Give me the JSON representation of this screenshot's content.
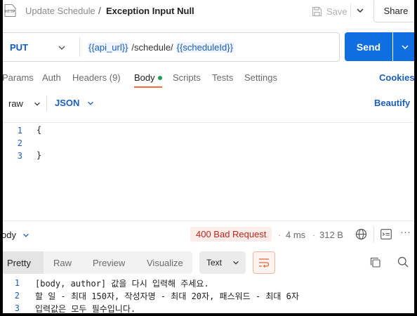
{
  "header": {
    "icon_label": "HTTP",
    "breadcrumb_parent": "Update Schedule",
    "separator": "/",
    "title": "Exception Input Null",
    "save_label": "Save",
    "share_label": "Share"
  },
  "request": {
    "method": "PUT",
    "url_parts": [
      {
        "text": "{{api_url}}",
        "variable": true
      },
      {
        "text": "/schedule/",
        "variable": false
      },
      {
        "text": "{{scheduleId}}",
        "variable": true
      }
    ],
    "send_label": "Send"
  },
  "tabs": [
    {
      "label": "Params",
      "active": false
    },
    {
      "label": "Auth",
      "active": false
    },
    {
      "label": "Headers (9)",
      "active": false
    },
    {
      "label": "Body",
      "active": true,
      "has_dot": true
    },
    {
      "label": "Scripts",
      "active": false
    },
    {
      "label": "Tests",
      "active": false
    },
    {
      "label": "Settings",
      "active": false
    }
  ],
  "cookies_label": "Cookies",
  "body_options": {
    "mode": "raw",
    "format": "JSON",
    "beautify_label": "Beautify"
  },
  "editor_lines": [
    {
      "num": "1",
      "text": "{"
    },
    {
      "num": "2",
      "text": ""
    },
    {
      "num": "3",
      "text": "}"
    }
  ],
  "response": {
    "section_label": "ody",
    "status": "400 Bad Request",
    "time": "4 ms",
    "size": "312 B",
    "view_tabs": [
      "Pretty",
      "Raw",
      "Preview",
      "Visualize"
    ],
    "active_view": "Pretty",
    "text_format": "Text",
    "lines": [
      {
        "num": "1",
        "text": "[body, author] 값을 다시 입력해 주세요."
      },
      {
        "num": "2",
        "text": "할 일 - 최대 150자, 작성자명 - 최대 20자, 패스워드 - 최대 6자"
      },
      {
        "num": "3",
        "text": "입력값은 모두 필수입니다."
      }
    ]
  },
  "colors": {
    "accent_blue": "#0f6ee0",
    "link_blue": "#1a5fbf",
    "tab_underline": "#ff6c37",
    "status_red": "#c0281c",
    "dot_green": "#1e9e55"
  },
  "icons": [
    "http-file-icon",
    "save-icon",
    "chevron-down-icon",
    "globe-icon",
    "example-icon",
    "more-icon",
    "wrap-icon",
    "copy-icon",
    "search-icon"
  ]
}
